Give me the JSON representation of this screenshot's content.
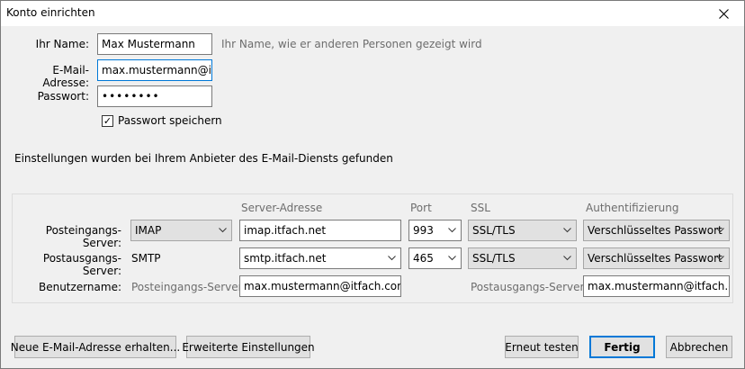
{
  "window": {
    "title": "Konto einrichten"
  },
  "form": {
    "name_label": "Ihr Name:",
    "name_value": "Max Mustermann",
    "name_hint": "Ihr Name, wie er anderen Personen gezeigt wird",
    "email_label": "E-Mail-Adresse:",
    "email_value": "max.mustermann@itfach.net",
    "password_label": "Passwort:",
    "password_value": "••••••••",
    "remember_label": "Passwort speichern",
    "remember_checked": "✓"
  },
  "status": {
    "message": "Einstellungen wurden bei Ihrem Anbieter des E-Mail-Diensts gefunden"
  },
  "server_table": {
    "headers": {
      "server_address": "Server-Adresse",
      "port": "Port",
      "ssl": "SSL",
      "auth": "Authentifizierung"
    },
    "incoming": {
      "label": "Posteingangs-Server:",
      "protocol": "IMAP",
      "host": "imap.itfach.net",
      "port": "993",
      "ssl": "SSL/TLS",
      "auth": "Verschlüsseltes Passwort"
    },
    "outgoing": {
      "label": "Postausgangs-Server:",
      "protocol": "SMTP",
      "host": "smtp.itfach.net",
      "port": "465",
      "ssl": "SSL/TLS",
      "auth": "Verschlüsseltes Passwort"
    },
    "username": {
      "label": "Benutzername:",
      "incoming_label": "Posteingangs-Server:",
      "incoming_value": "max.mustermann@itfach.com",
      "outgoing_label": "Postausgangs-Server:",
      "outgoing_value": "max.mustermann@itfach.com"
    }
  },
  "buttons": {
    "new_address": "Neue E-Mail-Adresse erhalten...",
    "advanced": "Erweiterte Einstellungen",
    "retest": "Erneut testen",
    "done": "Fertig",
    "cancel": "Abbrechen"
  },
  "icons": {
    "close": "close-icon",
    "chevron": "chevron-down-icon",
    "check": "check-icon"
  },
  "colors": {
    "focus": "#0078d7",
    "hint": "#6d6d6d",
    "background": "#f0f0f0"
  }
}
